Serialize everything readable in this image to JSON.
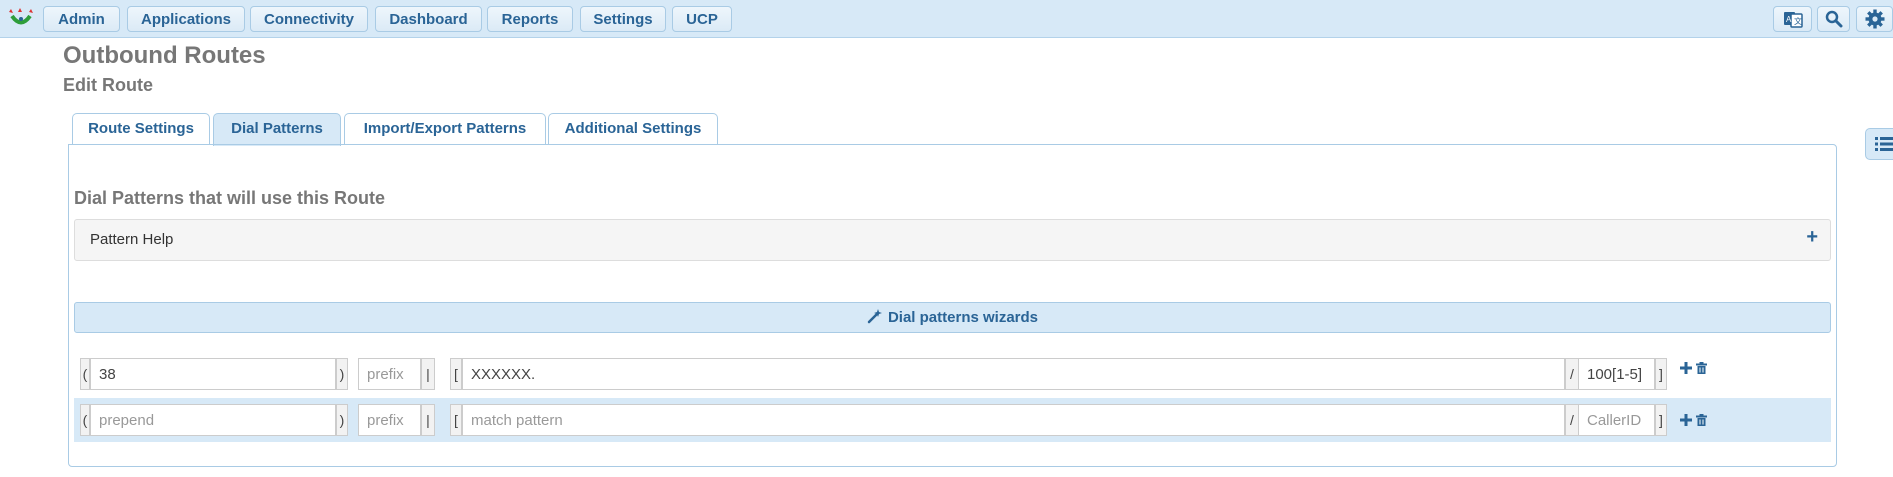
{
  "nav": {
    "items": [
      "Admin",
      "Applications",
      "Connectivity",
      "Dashboard",
      "Reports",
      "Settings",
      "UCP"
    ]
  },
  "header": {
    "title": "Outbound Routes",
    "subtitle": "Edit Route"
  },
  "tabs": [
    {
      "label": "Route Settings",
      "active": false
    },
    {
      "label": "Dial Patterns",
      "active": true
    },
    {
      "label": "Import/Export Patterns",
      "active": false
    },
    {
      "label": "Additional Settings",
      "active": false
    }
  ],
  "section": {
    "heading": "Dial Patterns that will use this Route",
    "pattern_help": "Pattern Help",
    "wizards_label": "Dial patterns wizards"
  },
  "pattern_symbols": {
    "open_paren": "(",
    "close_paren": ")",
    "pipe": "|",
    "open_bracket": "[",
    "slash": "/",
    "close_bracket": "]"
  },
  "patterns": [
    {
      "prepend": {
        "value": "38",
        "placeholder": "prepend"
      },
      "prefix": {
        "value": "",
        "placeholder": "prefix"
      },
      "match": {
        "value": "XXXXXX.",
        "placeholder": "match pattern"
      },
      "callerid": {
        "value": "100[1-5]",
        "placeholder": "CallerID"
      }
    },
    {
      "prepend": {
        "value": "",
        "placeholder": "prepend"
      },
      "prefix": {
        "value": "",
        "placeholder": "prefix"
      },
      "match": {
        "value": "",
        "placeholder": "match pattern"
      },
      "callerid": {
        "value": "",
        "placeholder": "CallerID"
      }
    }
  ],
  "icons": {
    "logo": "freepbx-logo",
    "language": "language-icon",
    "search": "search-icon",
    "settings": "gear-icon",
    "side_panel": "list-icon",
    "add": "plus-icon",
    "delete": "trash-icon",
    "wizard": "magic-wand-icon"
  },
  "colors": {
    "accent": "#2a6496",
    "bar_background": "#d7e9f7",
    "border": "#a9cbe5",
    "heading_gray": "#777777"
  }
}
